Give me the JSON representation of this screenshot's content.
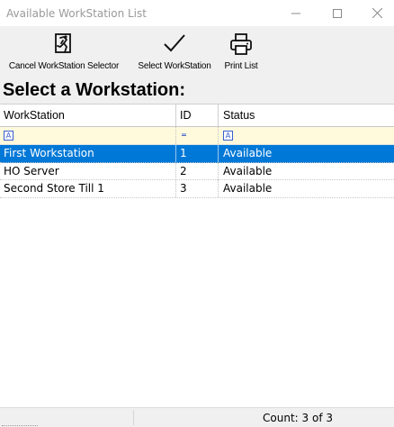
{
  "window": {
    "title": "Available WorkStation List"
  },
  "toolbar": {
    "cancel_label": "Cancel WorkStation Selector",
    "select_label": "Select WorkStation",
    "print_label": "Print List"
  },
  "heading": "Select a Workstation:",
  "grid": {
    "columns": [
      "WorkStation",
      "ID",
      "Status"
    ],
    "filter_symbols": [
      "A",
      "=",
      "A"
    ],
    "rows": [
      {
        "workstation": "First Workstation",
        "id": "1",
        "status": "Available",
        "selected": true
      },
      {
        "workstation": "HO Server",
        "id": "2",
        "status": "Available",
        "selected": false
      },
      {
        "workstation": "Second Store Till 1",
        "id": "3",
        "status": "Available",
        "selected": false
      }
    ]
  },
  "status": {
    "count": "Count: 3 of 3"
  },
  "colors": {
    "selection": "#0078d7",
    "filter_row": "#fffadc",
    "toolbar_bg": "#f0f0f0"
  },
  "icons": [
    "cancel-workstation-icon",
    "checkmark-icon",
    "printer-icon",
    "minimize-icon",
    "maximize-icon",
    "close-icon"
  ]
}
